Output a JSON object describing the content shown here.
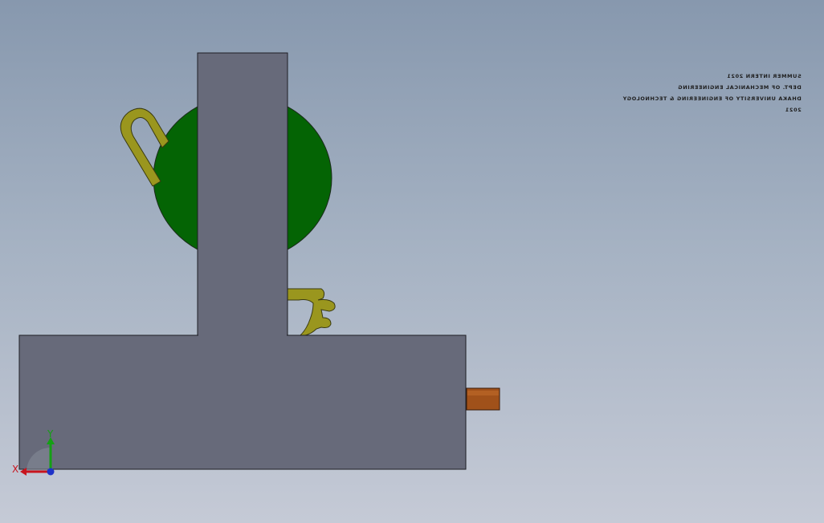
{
  "viewport": {
    "background_top": "#8798ae",
    "background_bottom": "#c5cad6"
  },
  "model": {
    "body_color": "#676a7a",
    "flywheel_color": "#046404",
    "linkage_color": "#9a961e",
    "shaft_color": "#a0511a"
  },
  "title_block": {
    "lines": [
      "SUMMER INTERN 2021",
      "DEPT. OF MECHANICAL ENGINEERING",
      "DHAKA UNIVERSITY OF ENGINEERING & TECHNOLOGY",
      "2021"
    ]
  },
  "triad": {
    "x_label": "X",
    "y_label": "Y",
    "x_color": "#c8141e",
    "y_color": "#14a014",
    "z_color": "#1e32c8"
  }
}
